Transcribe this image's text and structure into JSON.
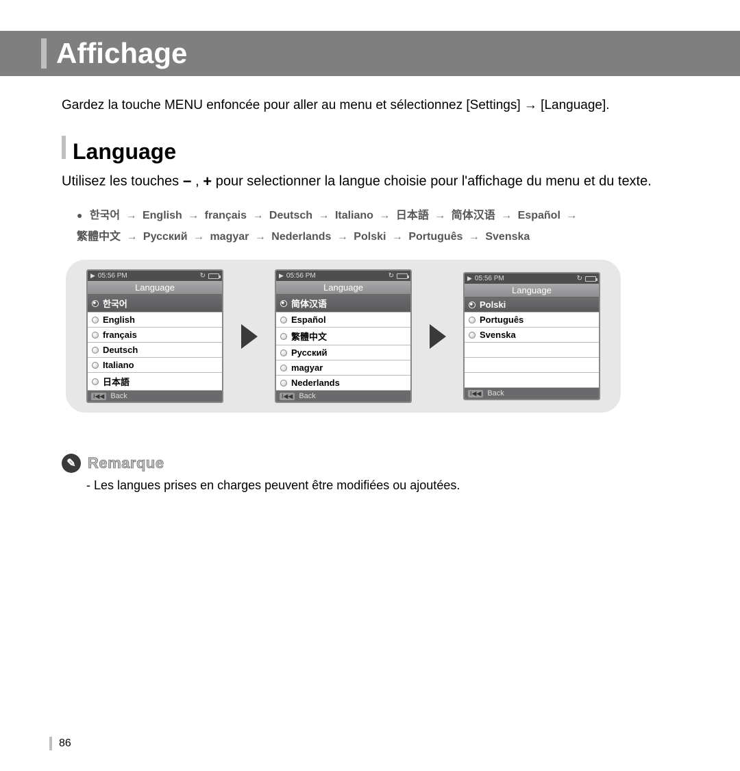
{
  "header": {
    "title": "Affichage"
  },
  "intro": "Gardez la touche MENU enfoncée pour aller au menu et sélectionnez [Settings] → [Language].",
  "section": {
    "title": "Language",
    "desc_pre": "Utilisez les touches ",
    "desc_mid": " , ",
    "desc_post": " pour selectionner la langue choisie pour l'affichage du menu et du texte.",
    "minus": "−",
    "plus": "+"
  },
  "lang_sequence": [
    "한국어",
    "English",
    "français",
    "Deutsch",
    "Italiano",
    "日本語",
    "简体汉语",
    "Español",
    "繁體中文",
    "Русский",
    "magyar",
    "Nederlands",
    "Polski",
    "Português",
    "Svenska"
  ],
  "status": {
    "time": "05:56 PM"
  },
  "screens": [
    {
      "title": "Language",
      "items": [
        {
          "label": "한국어",
          "selected": true
        },
        {
          "label": "English"
        },
        {
          "label": "français"
        },
        {
          "label": "Deutsch"
        },
        {
          "label": "Italiano"
        },
        {
          "label": "日本語"
        }
      ],
      "back": "Back"
    },
    {
      "title": "Language",
      "items": [
        {
          "label": "简体汉语",
          "selected": true
        },
        {
          "label": "Español"
        },
        {
          "label": "繁體中文"
        },
        {
          "label": "Русский"
        },
        {
          "label": "magyar"
        },
        {
          "label": "Nederlands"
        }
      ],
      "back": "Back"
    },
    {
      "title": "Language",
      "items": [
        {
          "label": "Polski",
          "selected": true
        },
        {
          "label": "Português"
        },
        {
          "label": "Svenska"
        },
        {
          "label": "",
          "empty": true
        },
        {
          "label": "",
          "empty": true
        },
        {
          "label": "",
          "empty": true
        }
      ],
      "back": "Back"
    }
  ],
  "note": {
    "icon_glyph": "✎",
    "label": "Remarque",
    "text": "- Les langues prises en charges peuvent être modifiées ou ajoutées."
  },
  "page_number": "86",
  "back_key": "I◀◀"
}
